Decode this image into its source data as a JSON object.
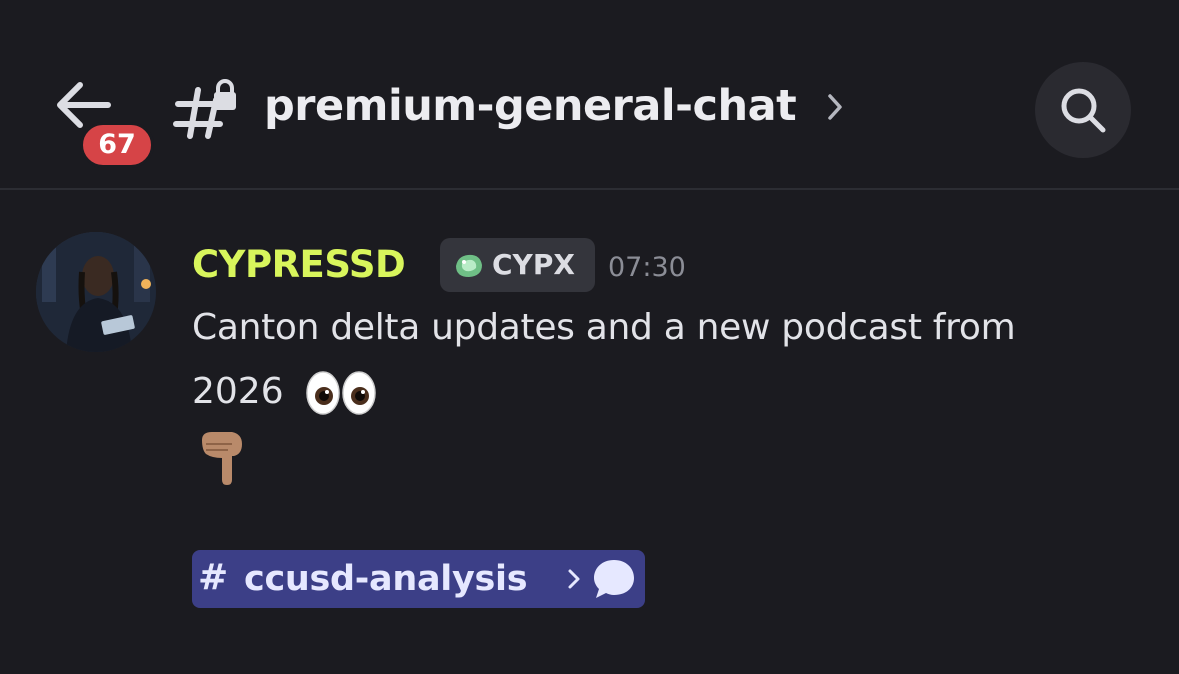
{
  "colors": {
    "background": "#1b1b20",
    "username": "#d8f55c",
    "badge": "#d64447",
    "mention_bg": "#3c3f87",
    "tag_bg": "#34353c"
  },
  "header": {
    "back_icon": "arrow-left-icon",
    "unread_count": "67",
    "channel_icon": "locked-hashtag-icon",
    "channel_name": "premium-general-chat",
    "chevron_icon": "chevron-right-icon",
    "search_icon": "search-icon"
  },
  "message": {
    "avatar": "user-avatar",
    "username": "CYPRESSD",
    "tag": {
      "icon": "green-gem-icon",
      "label": "CYPX"
    },
    "timestamp": "07:30",
    "lines": [
      "Canton delta updates and a new podcast from",
      "2026"
    ],
    "emojis": [
      "eyes-emoji",
      "pointing-down-emoji"
    ],
    "channel_mention": {
      "hash": "#",
      "name": "ccusd-analysis",
      "chevron_icon": "chevron-right-icon",
      "thread_icon": "chat-bubble-icon"
    }
  }
}
